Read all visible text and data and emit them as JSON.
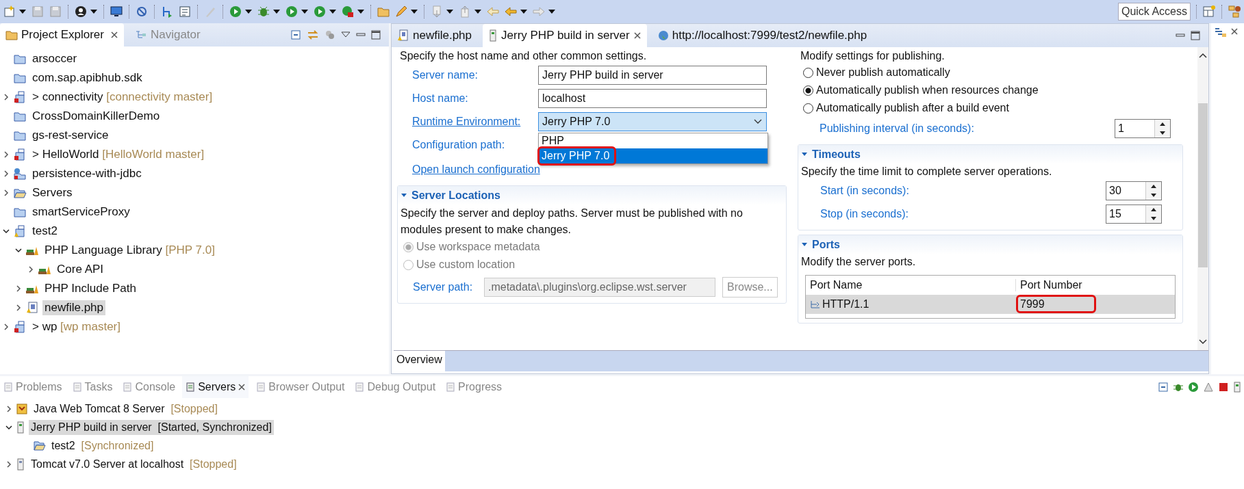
{
  "toolbar": {
    "quick_access": "Quick Access"
  },
  "explorer": {
    "tabs": [
      {
        "label": "Project Explorer",
        "selected": true
      },
      {
        "label": "Navigator",
        "selected": false
      }
    ],
    "tree": [
      {
        "label": "arsoccer",
        "kind": "project",
        "selected": false
      },
      {
        "label": "com.sap.apibhub.sdk",
        "kind": "project",
        "selected": false
      },
      {
        "label": "connectivity",
        "kind": "git-project",
        "expanded": false,
        "selected": false,
        "dirty": ">",
        "branch": "[connectivity master]"
      },
      {
        "label": "CrossDomainKillerDemo",
        "kind": "project",
        "selected": false
      },
      {
        "label": "gs-rest-service",
        "kind": "project",
        "selected": false
      },
      {
        "label": "HelloWorld",
        "kind": "git-project",
        "expanded": false,
        "selected": false,
        "dirty": ">",
        "branch": "[HelloWorld master]"
      },
      {
        "label": "persistence-with-jdbc",
        "kind": "web-project",
        "expanded": false,
        "selected": false
      },
      {
        "label": "Servers",
        "kind": "open-folder",
        "expanded": false,
        "selected": false
      },
      {
        "label": "smartServiceProxy",
        "kind": "project",
        "selected": false
      },
      {
        "label": "test2",
        "kind": "php-project",
        "expanded": true,
        "selected": false,
        "children": [
          {
            "label": "PHP Language Library",
            "kind": "library",
            "expanded": true,
            "selected": false,
            "branch": "[PHP 7.0]",
            "children": [
              {
                "label": "Core API",
                "kind": "library",
                "expanded": false,
                "selected": false
              }
            ]
          },
          {
            "label": "PHP Include Path",
            "kind": "library",
            "expanded": false,
            "selected": false
          },
          {
            "label": "newfile.php",
            "kind": "php-file",
            "expanded": false,
            "selected": true
          }
        ]
      },
      {
        "label": "wp",
        "kind": "git-php-project",
        "expanded": false,
        "selected": false,
        "dirty": ">",
        "branch": "[wp master]"
      }
    ]
  },
  "editor": {
    "tabs": [
      {
        "label": "newfile.php",
        "kind": "php",
        "selected": false
      },
      {
        "label": "Jerry PHP build in server",
        "kind": "server",
        "selected": true
      },
      {
        "label": "http://localhost:7999/test2/newfile.php",
        "kind": "web",
        "selected": false
      }
    ],
    "general": {
      "intro": "Specify the host name and other common settings.",
      "fields": [
        {
          "label": "Server name:",
          "kind": "text",
          "value": "Jerry PHP build in server"
        },
        {
          "label": "Host name:",
          "kind": "text",
          "value": "localhost"
        },
        {
          "label": "Runtime Environment:",
          "kind": "combo",
          "value": "Jerry PHP 7.0",
          "expanded": true,
          "options": [
            {
              "label": "PHP",
              "selected": false,
              "highlighted": false
            },
            {
              "label": "Jerry PHP 7.0",
              "selected": true,
              "highlighted": true
            }
          ]
        },
        {
          "label": "Configuration path:",
          "kind": "label"
        }
      ],
      "link": "Open launch configuration"
    },
    "locations": {
      "title": "Server Locations",
      "description": "Specify the server and deploy paths. Server must be published with no modules present to make changes.",
      "options": [
        {
          "label": "Use workspace metadata",
          "selected": true,
          "disabled": true
        },
        {
          "label": "Use custom location",
          "selected": false,
          "disabled": true
        }
      ],
      "path_label": "Server path:",
      "path": ".metadata\\.plugins\\org.eclipse.wst.server",
      "browse": "Browse..."
    },
    "publishing": {
      "intro": "Modify settings for publishing.",
      "options": [
        {
          "label": "Never publish automatically",
          "selected": false
        },
        {
          "label": "Automatically publish when resources change",
          "selected": true
        },
        {
          "label": "Automatically publish after a build event",
          "selected": false
        }
      ],
      "interval_label": "Publishing interval (in seconds):",
      "interval": "1"
    },
    "timeouts": {
      "title": "Timeouts",
      "description": "Specify the time limit to complete server operations.",
      "fields": [
        {
          "label": "Start (in seconds):",
          "value": "30"
        },
        {
          "label": "Stop (in seconds):",
          "value": "15"
        }
      ]
    },
    "ports": {
      "title": "Ports",
      "description": "Modify the server ports.",
      "columns": [
        "Port Name",
        "Port Number"
      ],
      "rows": [
        {
          "name": "HTTP/1.1",
          "number": "7999",
          "selected": true,
          "highlighted": true
        }
      ]
    },
    "pages": [
      {
        "label": "Overview",
        "selected": true
      }
    ]
  },
  "bottom": {
    "tabs": [
      {
        "label": "Problems",
        "selected": false
      },
      {
        "label": "Tasks",
        "selected": false
      },
      {
        "label": "Console",
        "selected": false
      },
      {
        "label": "Servers",
        "selected": true
      },
      {
        "label": "Browser Output",
        "selected": false
      },
      {
        "label": "Debug Output",
        "selected": false
      },
      {
        "label": "Progress",
        "selected": false
      }
    ],
    "servers": [
      {
        "name": "Java Web Tomcat 8 Server",
        "status": "[Stopped]",
        "kind": "tomcat8",
        "expanded": false,
        "selected": false
      },
      {
        "name": "Jerry PHP build in server",
        "status": "[Started, Synchronized]",
        "kind": "server",
        "expanded": true,
        "selected": true,
        "children": [
          {
            "name": "test2",
            "status": "[Synchronized]",
            "kind": "module",
            "selected": false
          }
        ]
      },
      {
        "name": "Tomcat v7.0 Server at localhost",
        "status": "[Stopped]",
        "kind": "server",
        "expanded": false,
        "selected": false
      }
    ]
  }
}
